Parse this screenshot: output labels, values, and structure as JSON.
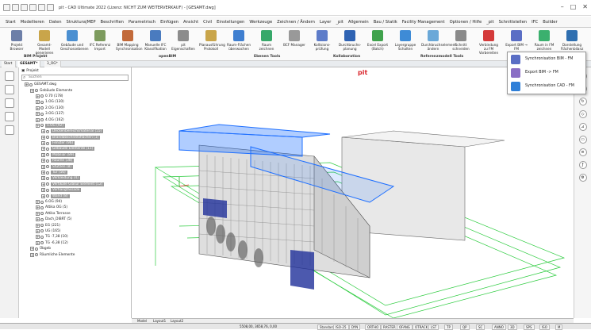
{
  "window": {
    "title": "pit - CAD Ultimate 2022 (Lizenz: NICHT ZUM WEITERVERKAUF) - [GESAMT.dwg]"
  },
  "ribbon_tabs": [
    "Start",
    "Modellieren",
    "Daten",
    "Struktura|MEP",
    "Beschriften",
    "Parametrisch",
    "Einfügen",
    "Ansicht",
    "Civil",
    "Einstellungen",
    "Werkzeuge",
    "Zeichnen / Ändern",
    "Layer",
    "_pit",
    "Allgemein",
    "Bau / Statik",
    "Facility Management",
    "Optionen / Hilfe",
    "_pit",
    "Schnittstellen",
    "IFC",
    "Builder"
  ],
  "active_tab": "BIM",
  "ribbon_buttons": [
    {
      "label": "Projekt Browser"
    },
    {
      "label": "Gesamt-Modell generieren"
    },
    {
      "label": "Gebäude und Geschossebenen"
    },
    {
      "label": "IFC Referenz Import"
    },
    {
      "label": "BIM Mapping Synchronisation"
    },
    {
      "label": "Manuelle IFC Klassifikation"
    },
    {
      "label": "pit Eigenschaften"
    },
    {
      "label": "Planausführung Protokoll"
    },
    {
      "label": "Raum-Flächen überwachen"
    },
    {
      "label": "Raum zeichnen"
    },
    {
      "label": "BCF Manager"
    },
    {
      "label": "Kollisions-prüfung"
    },
    {
      "label": "Durchbruchs-planung"
    },
    {
      "label": "Excel Export (Batch)"
    },
    {
      "label": "Layergruppe Schalten"
    },
    {
      "label": "Durchbruchselement ändern"
    },
    {
      "label": "Schnitt schneiden"
    },
    {
      "label": "Verbindung zu FM Vorbereiten"
    },
    {
      "label": "Export BIM → FM"
    },
    {
      "label": "Raum in FM zeichnen"
    },
    {
      "label": "Darstellung Flächenbilanz"
    }
  ],
  "ribbon_groups": [
    "BIM Projekt",
    "openBIM",
    "Ebenen Tools",
    "Kollaboration",
    "Referenzmodell Tools"
  ],
  "doc_tabs": [
    "Start",
    "GESAMT*",
    "3_OG*"
  ],
  "tree": {
    "root": "Projekt",
    "search_placeholder": "Suchen",
    "nodes": [
      {
        "label": "GESAMT.dwg",
        "indent": 1,
        "selected": false
      },
      {
        "label": "Gebäude Elemente",
        "indent": 2,
        "selected": false
      },
      {
        "label": "0.70 (178)",
        "indent": 3,
        "selected": false
      },
      {
        "label": "1.OG (130)",
        "indent": 3,
        "selected": false
      },
      {
        "label": "2.OG (130)",
        "indent": 3,
        "selected": false
      },
      {
        "label": "3.OG (137)",
        "indent": 3,
        "selected": false
      },
      {
        "label": "4.OG (162)",
        "indent": 3,
        "selected": false
      },
      {
        "label": "5.OG (92)",
        "indent": 3,
        "selected": true
      },
      {
        "label": "Deckenbereichsmaterial (55)",
        "indent": 4,
        "selected": true
      },
      {
        "label": "Brandabschnittsflächen (1)",
        "indent": 4,
        "selected": true
      },
      {
        "label": "Fenster (96)",
        "indent": 4,
        "selected": true
      },
      {
        "label": "Gebäude Elemente (11)",
        "indent": 4,
        "selected": true
      },
      {
        "label": "Mobiliar (89)",
        "indent": 4,
        "selected": true
      },
      {
        "label": "Räume (38)",
        "indent": 4,
        "selected": true
      },
      {
        "label": "Stützen (8)",
        "indent": 4,
        "selected": true
      },
      {
        "label": "Tür (56)",
        "indent": 4,
        "selected": true
      },
      {
        "label": "Verkleidung (4)",
        "indent": 4,
        "selected": true
      },
      {
        "label": "Vertikale Glasur Element (12)",
        "indent": 4,
        "selected": true
      },
      {
        "label": "Vorhangfassade",
        "indent": 4,
        "selected": true
      },
      {
        "label": "Wand (8)",
        "indent": 4,
        "selected": true
      },
      {
        "label": "6.OG (94)",
        "indent": 3,
        "selected": false
      },
      {
        "label": "Attika OG (5)",
        "indent": 3,
        "selected": false
      },
      {
        "label": "Attika Terrasse",
        "indent": 3,
        "selected": false
      },
      {
        "label": "Dach_DIBRT (5)",
        "indent": 3,
        "selected": false
      },
      {
        "label": "EG (221)",
        "indent": 3,
        "selected": false
      },
      {
        "label": "UG (165)",
        "indent": 3,
        "selected": false
      },
      {
        "label": "TG -7,38 (10)",
        "indent": 3,
        "selected": false
      },
      {
        "label": "TG -6,38 (12)",
        "indent": 3,
        "selected": false
      },
      {
        "label": "Übgeb",
        "indent": 2,
        "selected": false
      },
      {
        "label": "Räumliche Elemente",
        "indent": 2,
        "selected": false
      }
    ]
  },
  "popup": {
    "items": [
      "Synchronisation BIM - FM",
      "Export BIM -> FM",
      "Synchronisation CAD - FM"
    ]
  },
  "bottom_tabs": [
    "Model",
    "Layout1",
    "Layout2"
  ],
  "status": {
    "coords": "5508,00, 3658,76, 0,00",
    "items": [
      "Standard",
      "ISO-25",
      "DYN",
      "ORTHO",
      "RASTER",
      "OFANG",
      "OTRACK",
      "LST",
      "TP",
      "QP",
      "SC",
      "ANNO",
      "3D",
      "SPS",
      "ISO",
      "M"
    ]
  },
  "colors": {
    "accent": "#3b7dd8",
    "selection": "#9a9a9a",
    "building_wall": "#e6e6e6",
    "highlight": "#1e6fff",
    "level_lines": "#2ecc40"
  }
}
